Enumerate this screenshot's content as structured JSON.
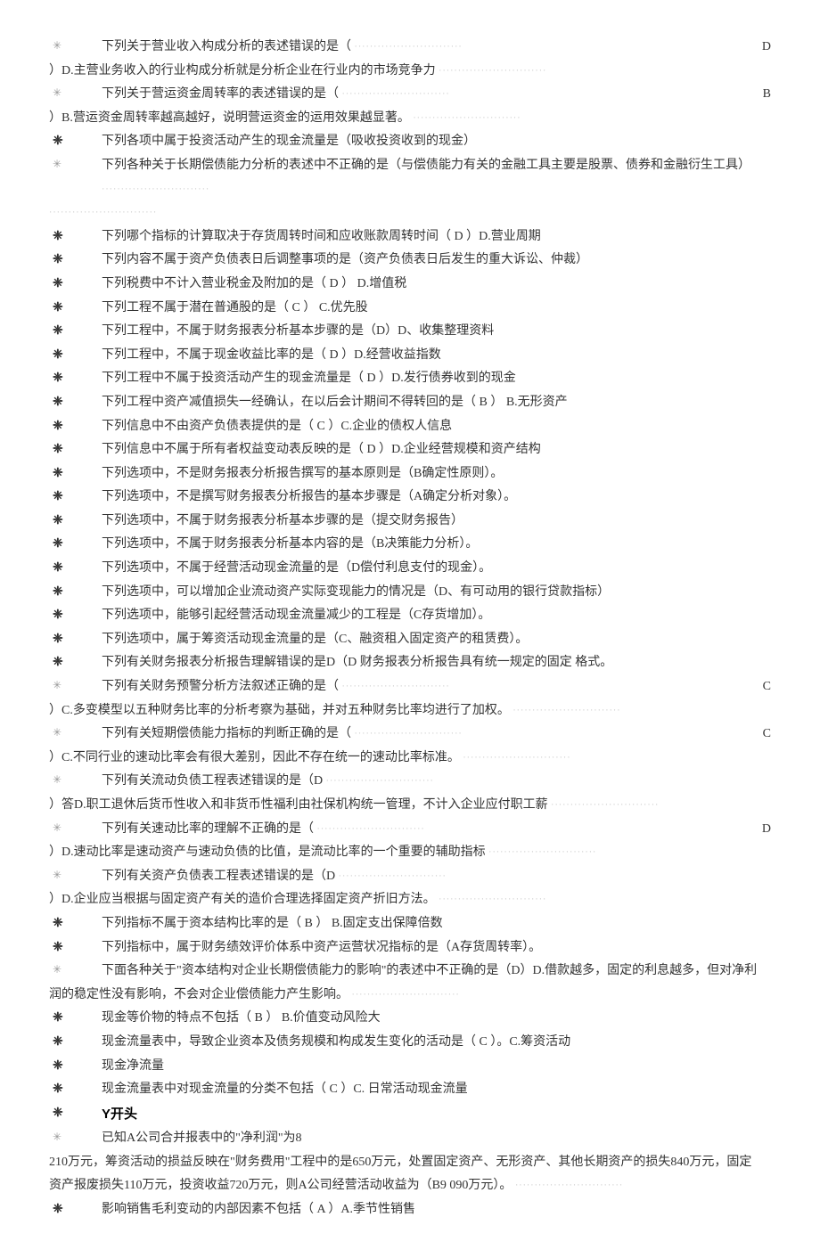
{
  "items": [
    {
      "bullet": "✳",
      "bulletStrong": false,
      "text": "下列关于营业收入构成分析的表述错误的是（",
      "right": "D",
      "trailingDots": true
    },
    {
      "bullet": "",
      "text": "）D.主营业务收入的行业构成分析就是分析企业在行业内的市场竞争力",
      "wrap": true,
      "trailingDots": true
    },
    {
      "bullet": "✳",
      "bulletStrong": false,
      "text": "下列关于营运资金周转率的表述错误的是（",
      "right": "B",
      "trailingDots": true
    },
    {
      "bullet": "",
      "text": "）B.营运资金周转率越高越好，说明营运资金的运用效果越显著。",
      "wrap": true,
      "trailingDots": true
    },
    {
      "bullet": "❈",
      "bulletStrong": true,
      "text": "下列各项中属于投资活动产生的现金流量是（吸收投资收到的现金）"
    },
    {
      "bullet": "✳",
      "bulletStrong": false,
      "text": "下列各种关于长期偿债能力分析的表述中不正确的是（与偿债能力有关的金融工具主要是股票、债券和金融衍生工具）",
      "trailingDots": true
    },
    {
      "bullet": "",
      "text": " ",
      "wrap": true,
      "trailingDots": true
    },
    {
      "bullet": "❈",
      "bulletStrong": true,
      "text": "下列哪个指标的计算取决于存货周转时间和应收账款周转时间（ D ）D.营业周期"
    },
    {
      "bullet": "❈",
      "bulletStrong": true,
      "text": "下列内容不属于资产负债表日后调整事项的是（资产负债表日后发生的重大诉讼、仲裁）"
    },
    {
      "bullet": "❈",
      "bulletStrong": true,
      "text": "下列税费中不计入营业税金及附加的是（ D ）  D.增值税"
    },
    {
      "bullet": "❈",
      "bulletStrong": true,
      "text": "下列工程不属于潜在普通股的是（ C ）    C.优先股"
    },
    {
      "bullet": "❈",
      "bulletStrong": true,
      "text": "下列工程中，不属于财务报表分析基本步骤的是（D）D、收集整理资料"
    },
    {
      "bullet": "❈",
      "bulletStrong": true,
      "text": "下列工程中，不属于现金收益比率的是（ D ）D.经营收益指数"
    },
    {
      "bullet": "❈",
      "bulletStrong": true,
      "text": "下列工程中不属于投资活动产生的现金流量是（ D ）D.发行债券收到的现金"
    },
    {
      "bullet": "❈",
      "bulletStrong": true,
      "text": "下列工程中资产减值损失一经确认，在以后会计期间不得转回的是（ B ）  B.无形资产"
    },
    {
      "bullet": "❈",
      "bulletStrong": true,
      "text": "下列信息中不由资产负债表提供的是（ C ）C.企业的债权人信息"
    },
    {
      "bullet": "❈",
      "bulletStrong": true,
      "text": "下列信息中不属于所有者权益变动表反映的是（ D ）D.企业经营规模和资产结构"
    },
    {
      "bullet": "❈",
      "bulletStrong": true,
      "text": "下列选项中，不是财务报表分析报告撰写的基本原则是（B确定性原则）。"
    },
    {
      "bullet": "❈",
      "bulletStrong": true,
      "text": "下列选项中，不是撰写财务报表分析报告的基本步骤是（A确定分析对象）。"
    },
    {
      "bullet": "❈",
      "bulletStrong": true,
      "text": "下列选项中，不属于财务报表分析基本步骤的是（提交财务报告）"
    },
    {
      "bullet": "❈",
      "bulletStrong": true,
      "text": "下列选项中，不属于财务报表分析基本内容的是（B决策能力分析）。"
    },
    {
      "bullet": "❈",
      "bulletStrong": true,
      "text": "下列选项中，不属于经营活动现金流量的是（D偿付利息支付的现金）。"
    },
    {
      "bullet": "❈",
      "bulletStrong": true,
      "text": "下列选项中，可以增加企业流动资产实际变现能力的情况是（D、有可动用的银行贷款指标）"
    },
    {
      "bullet": "❈",
      "bulletStrong": true,
      "text": "下列选项中，能够引起经营活动现金流量减少的工程是（C存货增加）。"
    },
    {
      "bullet": "❈",
      "bulletStrong": true,
      "text": "下列选项中，属于筹资活动现金流量的是（C、融资租入固定资产的租赁费）。"
    },
    {
      "bullet": "❈",
      "bulletStrong": true,
      "text": "下列有关财务报表分析报告理解错误的是D（D 财务报表分析报告具有统一规定的固定 格式。"
    },
    {
      "bullet": "✳",
      "bulletStrong": false,
      "text": "下列有关财务预警分析方法叙述正确的是（",
      "right": "C",
      "trailingDots": true
    },
    {
      "bullet": "",
      "text": "）C.多变模型以五种财务比率的分析考察为基础，并对五种财务比率均进行了加权。",
      "wrap": true,
      "trailingDots": true
    },
    {
      "bullet": "✳",
      "bulletStrong": false,
      "text": "下列有关短期偿债能力指标的判断正确的是（",
      "right": "C",
      "trailingDots": true
    },
    {
      "bullet": "",
      "text": "）C.不同行业的速动比率会有很大差别，因此不存在统一的速动比率标准。",
      "wrap": true,
      "trailingDots": true
    },
    {
      "bullet": "✳",
      "bulletStrong": false,
      "text": "下列有关流动负债工程表述错误的是（D",
      "trailingDots": true
    },
    {
      "bullet": "",
      "text": "）答D.职工退休后货币性收入和非货币性福利由社保机构统一管理，不计入企业应付职工薪",
      "wrap": true,
      "trailingDots": true
    },
    {
      "bullet": "✳",
      "bulletStrong": false,
      "text": "下列有关速动比率的理解不正确的是（",
      "right": "D",
      "trailingDots": true
    },
    {
      "bullet": "",
      "text": "）D.速动比率是速动资产与速动负债的比值，是流动比率的一个重要的辅助指标",
      "wrap": true,
      "trailingDots": true
    },
    {
      "bullet": "✳",
      "bulletStrong": false,
      "text": "下列有关资产负债表工程表述错误的是（D",
      "trailingDots": true
    },
    {
      "bullet": "",
      "text": "）D.企业应当根据与固定资产有关的造价合理选择固定资产折旧方法。",
      "wrap": true,
      "trailingDots": true
    },
    {
      "bullet": "❈",
      "bulletStrong": true,
      "text": "下列指标不属于资本结构比率的是（ B ）  B.固定支出保障倍数"
    },
    {
      "bullet": "❈",
      "bulletStrong": true,
      "text": "下列指标中，属于财务绩效评价体系中资产运营状况指标的是（A存货周转率）。"
    },
    {
      "bullet": "✳",
      "bulletStrong": false,
      "text": "下面各种关于\"资本结构对企业长期偿债能力的影响\"的表述中不正确的是（D）D.借款越多，固定的利息越多，但对净利"
    },
    {
      "bullet": "",
      "text": "润的稳定性没有影响，不会对企业偿债能力产生影响。",
      "wrap": true,
      "trailingDots": true
    },
    {
      "bullet": "❈",
      "bulletStrong": true,
      "text": "现金等价物的特点不包括（ B ） B.价值变动风险大"
    },
    {
      "bullet": "❈",
      "bulletStrong": true,
      "text": "现金流量表中，导致企业资本及债务规模和构成发生变化的活动是（ C ）。C.筹资活动"
    },
    {
      "bullet": "❈",
      "bulletStrong": true,
      "text": "现金净流量"
    },
    {
      "bullet": "❈",
      "bulletStrong": true,
      "text": "现金流量表中对现金流量的分类不包括（ C ）C. 日常活动现金流量"
    },
    {
      "bullet": "❈",
      "bulletStrong": true,
      "text": "Y开头",
      "heading": true
    },
    {
      "bullet": "✳",
      "bulletStrong": false,
      "text": "已知A公司合并报表中的\"净利润\"为8"
    },
    {
      "bullet": "",
      "text": "210万元，筹资活动的损益反映在\"财务费用\"工程中的是650万元，处置固定资产、无形资产、其他长期资产的损失840万元，固定",
      "wrap": true
    },
    {
      "bullet": "",
      "text": "资产报废损失110万元，投资收益720万元，则A公司经营活动收益为（B9 090万元）。",
      "wrap": true,
      "trailingDots": true
    },
    {
      "bullet": "❈",
      "bulletStrong": true,
      "text": "影响销售毛利变动的内部因素不包括（ A ）A.季节性销售"
    }
  ]
}
